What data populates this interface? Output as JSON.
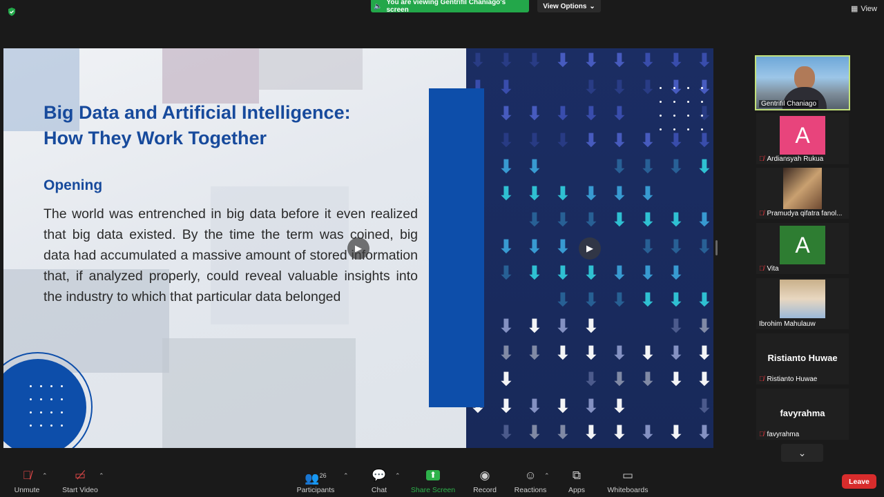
{
  "top_bar": {
    "viewing_text": "You are viewing Gentrifil Chaniago's screen",
    "view_options_label": "View Options",
    "view_label": "View"
  },
  "slide": {
    "title_line1": "Big Data and Artificial Intelligence:",
    "title_line2": "How They Work Together",
    "subheading": "Opening",
    "body": "The world was entrenched in big data before it even realized that big data existed. By the time the term was coined, big data had accumulated a massive amount of stored information that, if analyzed properly, could reveal valuable insights into the industry to which that particular data belonged",
    "accent_color": "#174a9c"
  },
  "participants_panel": {
    "tiles": [
      {
        "name": "Gentrifil Chaniago",
        "type": "video"
      },
      {
        "name": "Ardiansyah Rukua",
        "initial": "A",
        "color": "#e8447c",
        "muted": true
      },
      {
        "name": "Pramudya qifatra fanol...",
        "type": "photo",
        "muted": true
      },
      {
        "name": "Vita",
        "initial": "A",
        "color": "#2e7d32",
        "muted": true
      },
      {
        "name": "Ibrohim Mahulauw",
        "type": "photo",
        "muted": false
      },
      {
        "name": "Ristianto Huwae",
        "display": "Ristianto Huwae",
        "muted": true
      },
      {
        "name": "favyrahma",
        "display": "favyrahma",
        "muted": true
      }
    ]
  },
  "toolbar": {
    "unmute": "Unmute",
    "start_video": "Start Video",
    "participants": "Participants",
    "participants_count": "26",
    "chat": "Chat",
    "share_screen": "Share Screen",
    "record": "Record",
    "reactions": "Reactions",
    "apps": "Apps",
    "whiteboards": "Whiteboards",
    "leave": "Leave"
  }
}
